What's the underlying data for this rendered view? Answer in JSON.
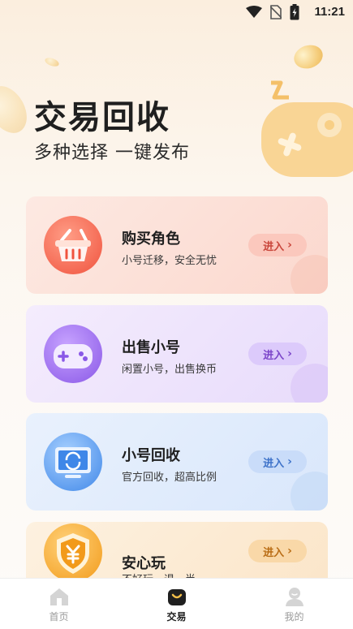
{
  "status_bar": {
    "time": "11:21"
  },
  "hero": {
    "title": "交易回收",
    "subtitle": "多种选择 一键发布"
  },
  "cards": [
    {
      "title": "购买角色",
      "desc": "小号迁移，安全无忧",
      "button": "进入"
    },
    {
      "title": "出售小号",
      "desc": "闲置小号，出售换币",
      "button": "进入"
    },
    {
      "title": "小号回收",
      "desc": "官方回收，超高比例",
      "button": "进入"
    },
    {
      "title": "安心玩",
      "desc": "不好玩，退一半",
      "button": "进入"
    }
  ],
  "bottom_nav": [
    {
      "label": "首页",
      "icon": "home-icon",
      "active": false
    },
    {
      "label": "交易",
      "icon": "bag-icon",
      "active": true
    },
    {
      "label": "我的",
      "icon": "user-icon",
      "active": false
    }
  ],
  "colors": {
    "accent_buy": "#f0533e",
    "accent_sell": "#8a58e7",
    "accent_recycle": "#3f87e8",
    "accent_safe": "#f29a1a"
  }
}
